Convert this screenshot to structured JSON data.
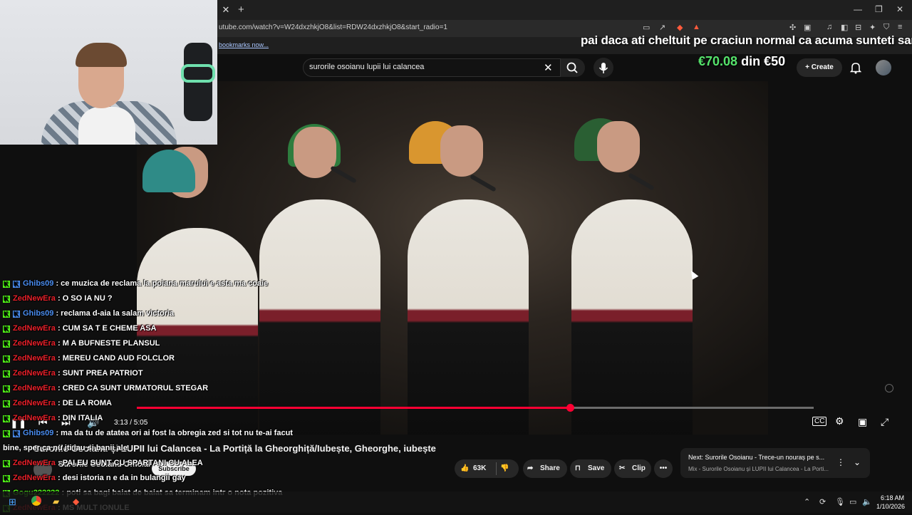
{
  "browser": {
    "url": "utube.com/watch?v=W24dxzhkjO8&list=RDW24dxzhkjO8&start_radio=1",
    "bookmarks_link": "bookmarks now...",
    "tab_close": "✕",
    "tab_new": "+"
  },
  "overlay": {
    "donation_message": "pai daca ati cheltuit pe craciun normal ca acuma sunteti saraci :",
    "donation_current": "€70.08",
    "donation_mid": "din",
    "donation_goal": "€50"
  },
  "youtube": {
    "search_value": "surorile osoianu lupii lui calancea",
    "create_label": "Create",
    "player": {
      "time": "3:13 / 5:05",
      "progress": 0.64
    },
    "video_title": "Surorile Osoianu și LUPII lui Calancea - La Portiță la Gheorghiță/Iubește, Gheorghe, iubește",
    "channel_name": "Surorile Osoianu Official",
    "subscribe_label": "Subscribe",
    "actions": {
      "likes": "63K",
      "share": "Share",
      "save": "Save",
      "clip": "Clip"
    },
    "next": {
      "label": "Next: Surorile Osoianu - Trece-un nouraș pe s...",
      "sub": "Mix - Surorile Osoianu și LUPII lui Calancea - La Porti..."
    }
  },
  "chat": [
    {
      "user": "Ghibs09",
      "color": "blue",
      "badges": 2,
      "text": ": ce muzica de reclama la poiana marului e asta ma coaie"
    },
    {
      "user": "ZedNewEra",
      "color": "red",
      "badges": 1,
      "text": ": O SO IA NU ?"
    },
    {
      "user": "Ghibs09",
      "color": "blue",
      "badges": 2,
      "text": ": reclama d-aia la salam victoria"
    },
    {
      "user": "ZedNewEra",
      "color": "red",
      "badges": 1,
      "text": ": CUM SA T E CHEME ASA"
    },
    {
      "user": "ZedNewEra",
      "color": "red",
      "badges": 1,
      "text": ": M A BUFNESTE PLANSUL"
    },
    {
      "user": "ZedNewEra",
      "color": "red",
      "badges": 1,
      "text": ": MEREU CAND AUD FOLCLOR"
    },
    {
      "user": "ZedNewEra",
      "color": "red",
      "badges": 1,
      "text": ": SUNT PREA PATRIOT"
    },
    {
      "user": "ZedNewEra",
      "color": "red",
      "badges": 1,
      "text": ": CRED CA SUNT URMATORUL STEGAR"
    },
    {
      "user": "ZedNewEra",
      "color": "red",
      "badges": 1,
      "text": ": DE LA ROMA"
    },
    {
      "user": "ZedNewEra",
      "color": "red",
      "badges": 1,
      "text": ": DIN ITALIA"
    },
    {
      "user": "Ghibs09",
      "color": "blue",
      "badges": 2,
      "text": ": ma da tu de atatea ori ai fost la obregia zed si tot nu te-ai facut"
    },
    {
      "user": "",
      "color": "none",
      "badges": 0,
      "text": "bine, sper ca nu iti iau si banii ale"
    },
    {
      "user": "ZedNewEra",
      "color": "red",
      "badges": 1,
      "text": ": PAI EU SUNT CU SPARTANI CU ALEA"
    },
    {
      "user": "ZedNewEra",
      "color": "red",
      "badges": 1,
      "text": ": desi istoria n e da in bulangii gay"
    },
    {
      "user": "Gogu222222",
      "color": "green",
      "badges": 1,
      "text": ": poti sa bagi baiat de baiat sa terminam intr o nota pozitiva"
    },
    {
      "user": "ZedNewEra",
      "color": "red",
      "badges": 1,
      "text": ": MS MULT IONULE"
    }
  ],
  "taskbar": {
    "time": "6:18 AM",
    "date": "1/10/2026"
  },
  "colors": {
    "progress": "#ff0033",
    "chat_red": "#e8202a",
    "chat_green": "#53fc18",
    "chat_blue": "#4a8df0"
  }
}
